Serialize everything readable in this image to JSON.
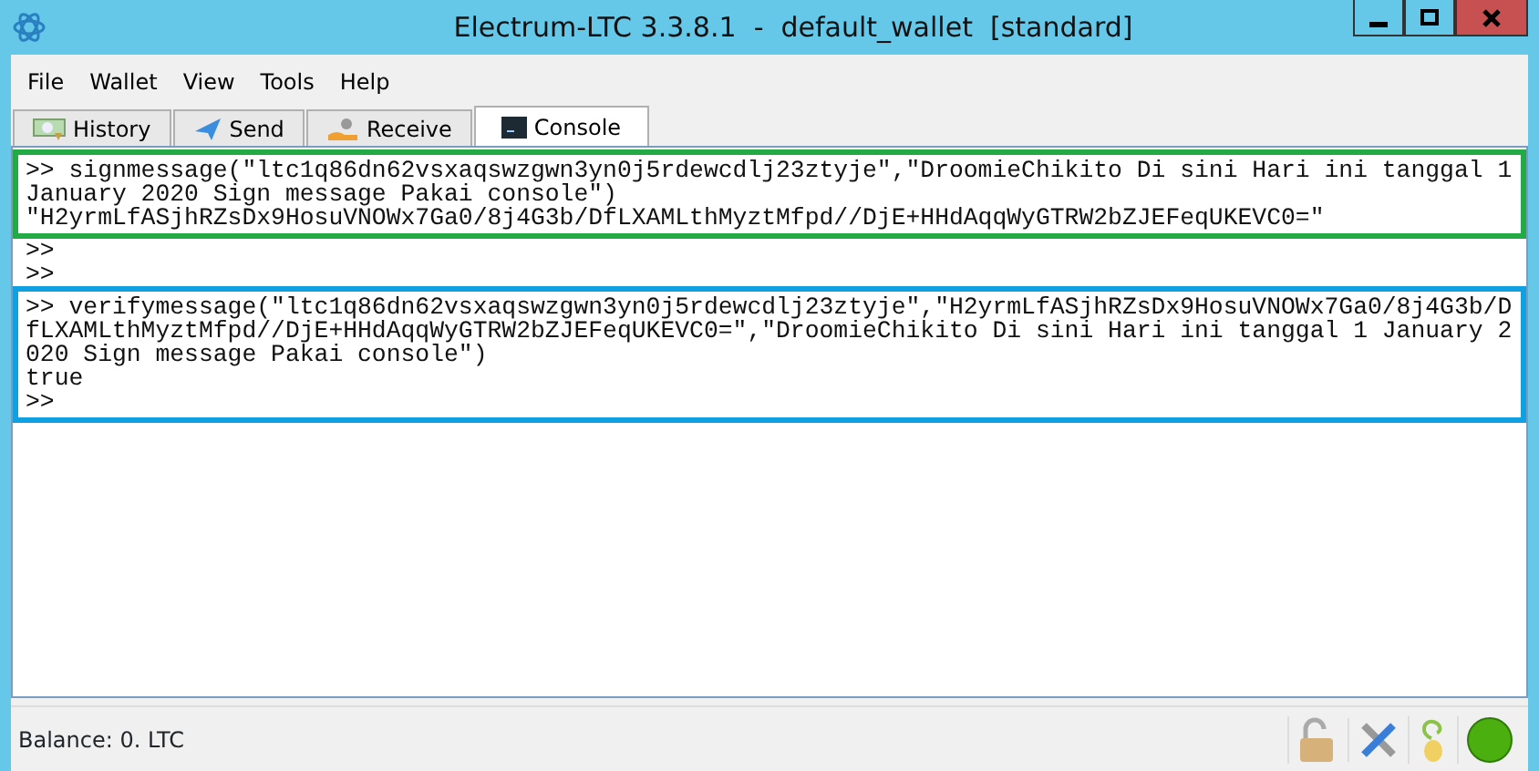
{
  "window": {
    "title": "Electrum-LTC 3.3.8.1  -  default_wallet  [standard]"
  },
  "menu": [
    "File",
    "Wallet",
    "View",
    "Tools",
    "Help"
  ],
  "tabs": [
    {
      "label": "History",
      "selected": false
    },
    {
      "label": "Send",
      "selected": false
    },
    {
      "label": "Receive",
      "selected": false
    },
    {
      "label": "Console",
      "selected": true
    }
  ],
  "console": {
    "blocks": [
      {
        "color": "#22aa44",
        "lines": [
          ">> signmessage(\"ltc1q86dn62vsxaqswzgwn3yn0j5rdewcdlj23ztyje\",\"DroomieChikito Di sini Hari ini tanggal 1",
          "January 2020 Sign message Pakai console\")",
          "\"H2yrmLfASjhRZsDx9HosuVNOWx7Ga0/8j4G3b/DfLXAMLthMyztMfpd//DjE+HHdAqqWyGTRW2bZJEFeqUKEVC0=\""
        ]
      },
      {
        "lines": [
          ">>",
          ">>"
        ]
      },
      {
        "color": "#0ea0e0",
        "lines": [
          ">> verifymessage(\"ltc1q86dn62vsxaqswzgwn3yn0j5rdewcdlj23ztyje\",\"H2yrmLfASjhRZsDx9HosuVNOWx7Ga0/8j4G3b/D",
          "fLXAMLthMyztMfpd//DjE+HHdAqqWyGTRW2bZJEFeqUKEVC0=\",\"DroomieChikito Di sini Hari ini tanggal 1 January 2",
          "020 Sign message Pakai console\")",
          "true",
          ">>"
        ]
      }
    ]
  },
  "status_bar": {
    "balance": "Balance: 0. LTC"
  }
}
